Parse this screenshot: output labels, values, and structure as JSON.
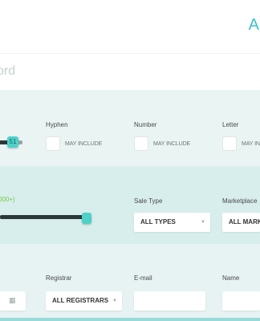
{
  "header": {
    "letter": "A"
  },
  "keyword": {
    "text": "ord"
  },
  "slider1": {
    "value_label": "51"
  },
  "slider2": {
    "label_text": "000+)"
  },
  "filters": {
    "hyphen": {
      "label": "Hyphen",
      "option": "MAY INCLUDE"
    },
    "number": {
      "label": "Number",
      "option": "MAY INCLUDE"
    },
    "letter": {
      "label": "Letter",
      "option": "MAY IN"
    }
  },
  "sale": {
    "sale_type": {
      "label": "Sale Type",
      "value": "ALL TYPES"
    },
    "marketplace": {
      "label": "Marketplace",
      "value": "ALL MARK"
    }
  },
  "registry": {
    "registrar": {
      "label": "Registrar",
      "value": "ALL REGISTRARS"
    },
    "email": {
      "label": "E-mail",
      "value": ""
    },
    "name": {
      "label": "Name",
      "value": ""
    }
  }
}
